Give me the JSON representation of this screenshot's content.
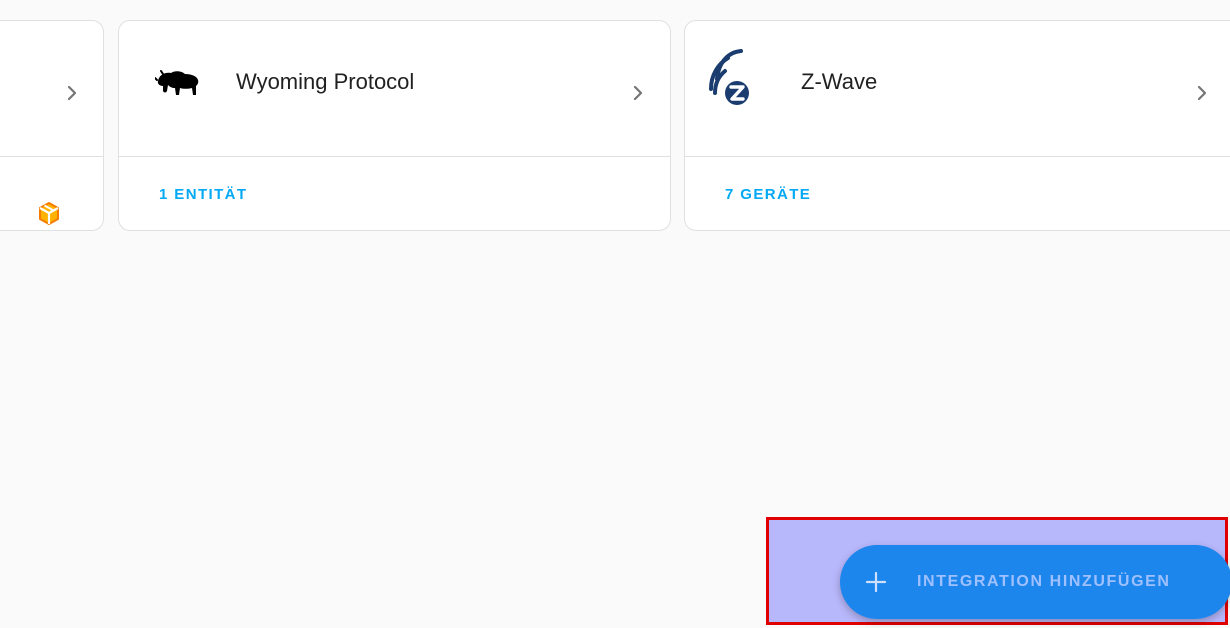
{
  "integrations": [
    {
      "title": "",
      "link": "",
      "logo": "cube-package-icon",
      "link_icon_color": "#ff9800"
    },
    {
      "title": "Wyoming Protocol",
      "link": "1 ENTITÄT",
      "logo": "bison-icon"
    },
    {
      "title": "Z-Wave",
      "link": "7 GERÄTE",
      "logo": "zwave-icon",
      "logo_color": "#1a3c6e"
    }
  ],
  "fab": {
    "label": "INTEGRATION HINZUFÜGEN",
    "icon": "plus-icon",
    "color": "#1d86ec"
  },
  "colors": {
    "accent": "#03a9f4",
    "background": "#fafafa",
    "highlight_border": "#e00000"
  }
}
